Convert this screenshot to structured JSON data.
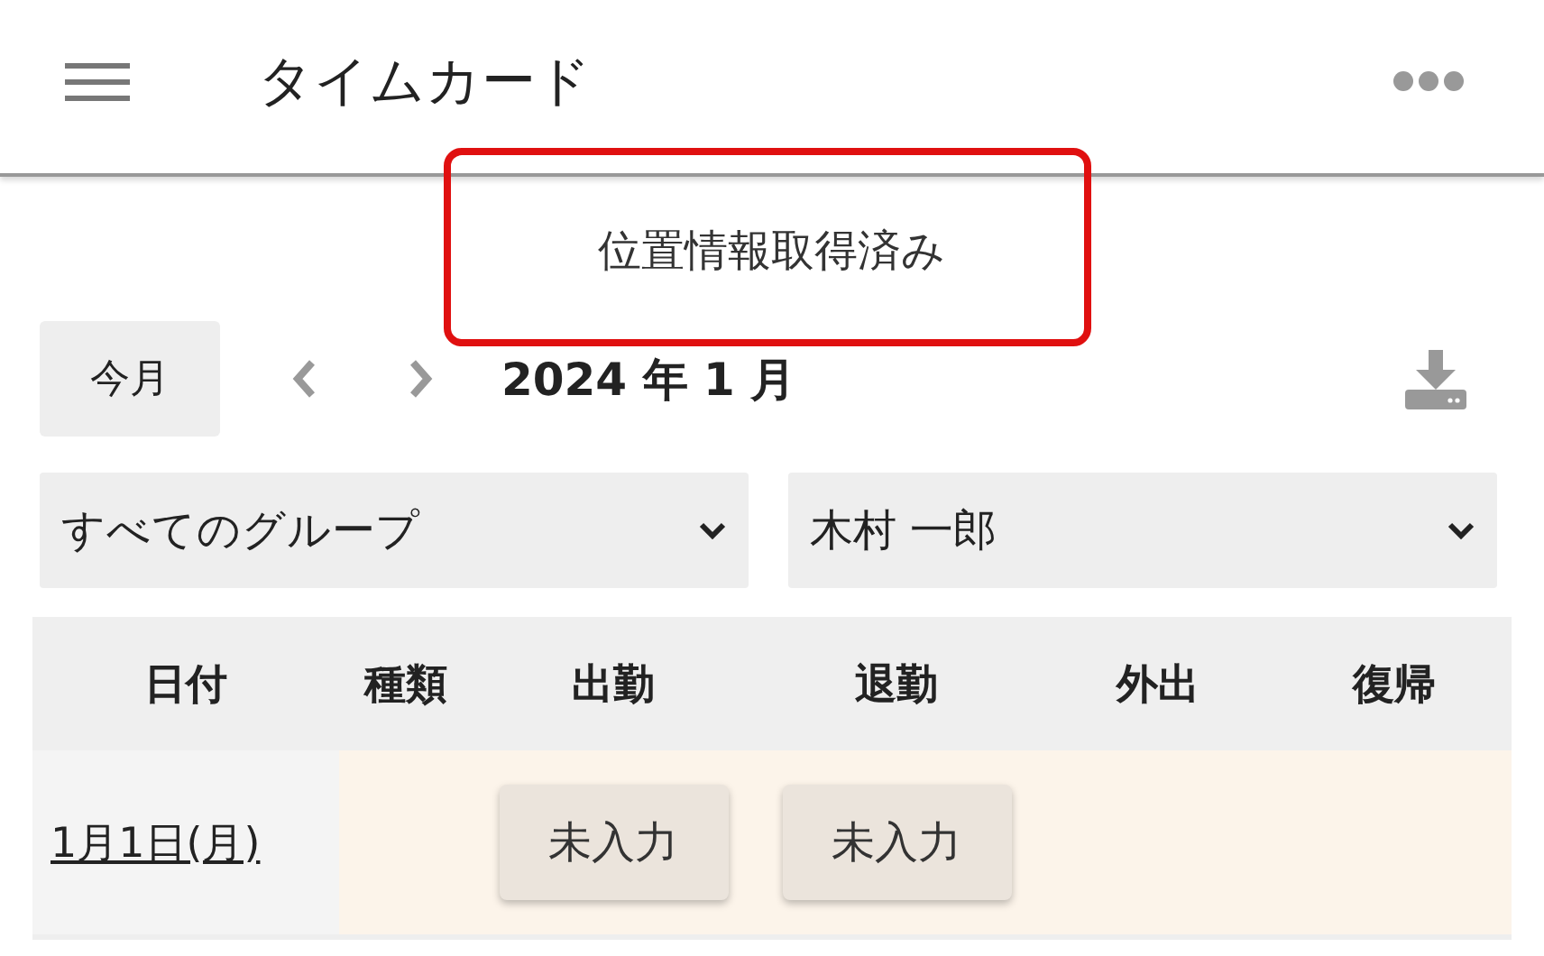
{
  "header": {
    "title": "タイムカード"
  },
  "location_status": "位置情報取得済み",
  "toolbar": {
    "this_month_button": "今月",
    "period": "2024 年 1 月"
  },
  "filters": {
    "group": "すべてのグループ",
    "employee": "木村 一郎"
  },
  "table": {
    "columns": [
      "日付",
      "種類",
      "出勤",
      "退勤",
      "外出",
      "復帰"
    ],
    "rows": [
      {
        "date": "1月1日(月)",
        "clock_in": "未入力",
        "clock_out": "未入力"
      }
    ]
  }
}
